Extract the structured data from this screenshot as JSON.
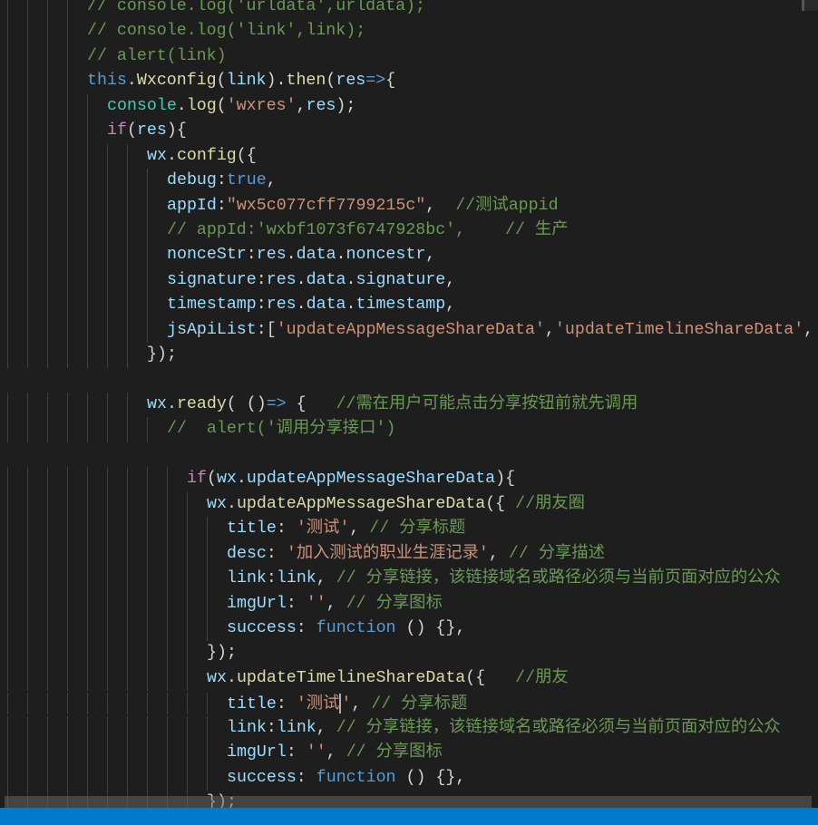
{
  "colors": {
    "background": "#1e1e1e",
    "statusbar": "#007acc",
    "comment": "#6a9955",
    "keyword": "#569cd6",
    "string": "#ce9178",
    "function": "#dcdcaa",
    "variable": "#9cdcfe"
  },
  "editor": {
    "current_line": 28,
    "cursor_after_token": 2,
    "lines": [
      {
        "indent": 8,
        "tokens": [
          [
            "c",
            "// console.log('urldata',urldata);"
          ]
        ]
      },
      {
        "indent": 8,
        "tokens": [
          [
            "c",
            "// console.log('link',link);"
          ]
        ]
      },
      {
        "indent": 8,
        "tokens": [
          [
            "c",
            "// alert(link)"
          ]
        ]
      },
      {
        "indent": 8,
        "tokens": [
          [
            "kw",
            "this"
          ],
          [
            "p",
            "."
          ],
          [
            "fn",
            "Wxconfig"
          ],
          [
            "p",
            "("
          ],
          [
            "v",
            "link"
          ],
          [
            "p",
            ")."
          ],
          [
            "fn",
            "then"
          ],
          [
            "p",
            "("
          ],
          [
            "v",
            "res"
          ],
          [
            "kw",
            "=>"
          ],
          [
            "p",
            "{"
          ]
        ]
      },
      {
        "indent": 10,
        "tokens": [
          [
            "cls",
            "console"
          ],
          [
            "p",
            "."
          ],
          [
            "fn",
            "log"
          ],
          [
            "p",
            "("
          ],
          [
            "s",
            "'wxres'"
          ],
          [
            "p",
            ","
          ],
          [
            "v",
            "res"
          ],
          [
            "p",
            ");"
          ]
        ]
      },
      {
        "indent": 10,
        "tokens": [
          [
            "ctl",
            "if"
          ],
          [
            "p",
            "("
          ],
          [
            "v",
            "res"
          ],
          [
            "p",
            "){"
          ]
        ]
      },
      {
        "indent": 14,
        "tokens": [
          [
            "v",
            "wx"
          ],
          [
            "p",
            "."
          ],
          [
            "fn",
            "config"
          ],
          [
            "p",
            "({"
          ]
        ]
      },
      {
        "indent": 16,
        "tokens": [
          [
            "v",
            "debug"
          ],
          [
            "p",
            ":"
          ],
          [
            "kw",
            "true"
          ],
          [
            "p",
            ","
          ]
        ]
      },
      {
        "indent": 16,
        "tokens": [
          [
            "v",
            "appId"
          ],
          [
            "p",
            ":"
          ],
          [
            "s",
            "\"wx5c077cff7799215c\""
          ],
          [
            "p",
            ",  "
          ],
          [
            "c",
            "//测试appid"
          ]
        ]
      },
      {
        "indent": 16,
        "tokens": [
          [
            "c",
            "// appId:'wxbf1073f6747928bc',    // 生产"
          ]
        ]
      },
      {
        "indent": 16,
        "tokens": [
          [
            "v",
            "nonceStr"
          ],
          [
            "p",
            ":"
          ],
          [
            "v",
            "res"
          ],
          [
            "p",
            "."
          ],
          [
            "v",
            "data"
          ],
          [
            "p",
            "."
          ],
          [
            "v",
            "noncestr"
          ],
          [
            "p",
            ","
          ]
        ]
      },
      {
        "indent": 16,
        "tokens": [
          [
            "v",
            "signature"
          ],
          [
            "p",
            ":"
          ],
          [
            "v",
            "res"
          ],
          [
            "p",
            "."
          ],
          [
            "v",
            "data"
          ],
          [
            "p",
            "."
          ],
          [
            "v",
            "signature"
          ],
          [
            "p",
            ","
          ]
        ]
      },
      {
        "indent": 16,
        "tokens": [
          [
            "v",
            "timestamp"
          ],
          [
            "p",
            ":"
          ],
          [
            "v",
            "res"
          ],
          [
            "p",
            "."
          ],
          [
            "v",
            "data"
          ],
          [
            "p",
            "."
          ],
          [
            "v",
            "timestamp"
          ],
          [
            "p",
            ","
          ]
        ]
      },
      {
        "indent": 16,
        "tokens": [
          [
            "v",
            "jsApiList"
          ],
          [
            "p",
            ":["
          ],
          [
            "s",
            "'updateAppMessageShareData'"
          ],
          [
            "p",
            ","
          ],
          [
            "s",
            "'updateTimelineShareData'"
          ],
          [
            "p",
            ","
          ]
        ]
      },
      {
        "indent": 14,
        "tokens": [
          [
            "p",
            "});"
          ]
        ]
      },
      {
        "indent": 0,
        "tokens": []
      },
      {
        "indent": 14,
        "tokens": [
          [
            "v",
            "wx"
          ],
          [
            "p",
            "."
          ],
          [
            "fn",
            "ready"
          ],
          [
            "p",
            "( ()"
          ],
          [
            "kw",
            "=>"
          ],
          [
            "p",
            " {   "
          ],
          [
            "c",
            "//需在用户可能点击分享按钮前就先调用"
          ]
        ]
      },
      {
        "indent": 16,
        "tokens": [
          [
            "c",
            "//  alert('调用分享接口')"
          ]
        ]
      },
      {
        "indent": 0,
        "tokens": []
      },
      {
        "indent": 18,
        "tokens": [
          [
            "ctl",
            "if"
          ],
          [
            "p",
            "("
          ],
          [
            "v",
            "wx"
          ],
          [
            "p",
            "."
          ],
          [
            "v",
            "updateAppMessageShareData"
          ],
          [
            "p",
            "){"
          ]
        ]
      },
      {
        "indent": 20,
        "tokens": [
          [
            "v",
            "wx"
          ],
          [
            "p",
            "."
          ],
          [
            "fn",
            "updateAppMessageShareData"
          ],
          [
            "p",
            "({ "
          ],
          [
            "c",
            "//朋友圈"
          ]
        ]
      },
      {
        "indent": 22,
        "tokens": [
          [
            "v",
            "title"
          ],
          [
            "p",
            ": "
          ],
          [
            "s",
            "'测试'"
          ],
          [
            "p",
            ", "
          ],
          [
            "c",
            "// 分享标题"
          ]
        ]
      },
      {
        "indent": 22,
        "tokens": [
          [
            "v",
            "desc"
          ],
          [
            "p",
            ": "
          ],
          [
            "s",
            "'加入测试的职业生涯记录'"
          ],
          [
            "p",
            ", "
          ],
          [
            "c",
            "// 分享描述"
          ]
        ]
      },
      {
        "indent": 22,
        "tokens": [
          [
            "v",
            "link"
          ],
          [
            "p",
            ":"
          ],
          [
            "v",
            "link"
          ],
          [
            "p",
            ", "
          ],
          [
            "c",
            "// 分享链接，该链接域名或路径必须与当前页面对应的公众"
          ]
        ]
      },
      {
        "indent": 22,
        "tokens": [
          [
            "v",
            "imgUrl"
          ],
          [
            "p",
            ": "
          ],
          [
            "s",
            "''"
          ],
          [
            "p",
            ", "
          ],
          [
            "c",
            "// 分享图标"
          ]
        ]
      },
      {
        "indent": 22,
        "tokens": [
          [
            "v",
            "success"
          ],
          [
            "p",
            ": "
          ],
          [
            "kw",
            "function"
          ],
          [
            "p",
            " () {},"
          ]
        ]
      },
      {
        "indent": 20,
        "tokens": [
          [
            "p",
            "});"
          ]
        ]
      },
      {
        "indent": 20,
        "tokens": [
          [
            "v",
            "wx"
          ],
          [
            "p",
            "."
          ],
          [
            "fn",
            "updateTimelineShareData"
          ],
          [
            "p",
            "({   "
          ],
          [
            "c",
            "//朋友"
          ]
        ]
      },
      {
        "indent": 22,
        "tokens": [
          [
            "v",
            "title"
          ],
          [
            "p",
            ": "
          ],
          [
            "s",
            "'测试"
          ],
          [
            "s",
            "'"
          ],
          [
            "p",
            ", "
          ],
          [
            "c",
            "// 分享标题"
          ]
        ]
      },
      {
        "indent": 22,
        "tokens": [
          [
            "v",
            "link"
          ],
          [
            "p",
            ":"
          ],
          [
            "v",
            "link"
          ],
          [
            "p",
            ", "
          ],
          [
            "c",
            "// 分享链接，该链接域名或路径必须与当前页面对应的公众"
          ]
        ]
      },
      {
        "indent": 22,
        "tokens": [
          [
            "v",
            "imgUrl"
          ],
          [
            "p",
            ": "
          ],
          [
            "s",
            "''"
          ],
          [
            "p",
            ", "
          ],
          [
            "c",
            "// 分享图标"
          ]
        ]
      },
      {
        "indent": 22,
        "tokens": [
          [
            "v",
            "success"
          ],
          [
            "p",
            ": "
          ],
          [
            "kw",
            "function"
          ],
          [
            "p",
            " () {},"
          ]
        ]
      },
      {
        "indent": 20,
        "tokens": [
          [
            "p",
            "});"
          ]
        ]
      }
    ]
  }
}
